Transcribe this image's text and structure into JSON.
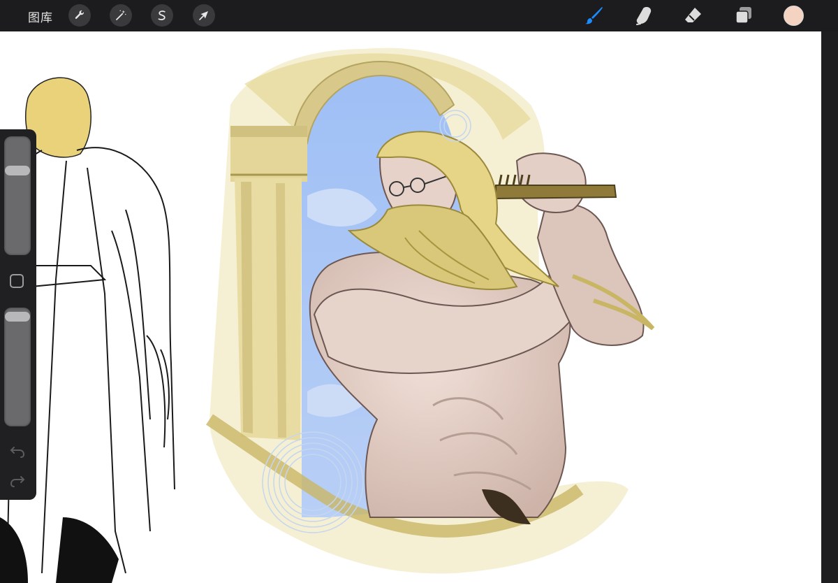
{
  "app": {
    "gallery_label": "图库"
  },
  "toolbar_left": [
    {
      "name": "actions",
      "icon": "wrench-icon"
    },
    {
      "name": "adjustments",
      "icon": "magic-wand-icon"
    },
    {
      "name": "selection",
      "icon": "selection-s-icon"
    },
    {
      "name": "transform",
      "icon": "arrow-cursor-icon"
    }
  ],
  "toolbar_right": [
    {
      "name": "brush",
      "icon": "brush-icon",
      "active": true
    },
    {
      "name": "smudge",
      "icon": "smudge-finger-icon",
      "active": false
    },
    {
      "name": "eraser",
      "icon": "eraser-icon",
      "active": false
    },
    {
      "name": "layers",
      "icon": "layers-icon",
      "active": false
    }
  ],
  "current_color": "#f4d3c2",
  "accent_color": "#1a8cff",
  "sidebar": {
    "brush_size_level": 0.75,
    "brush_opacity_level": 1.0
  }
}
